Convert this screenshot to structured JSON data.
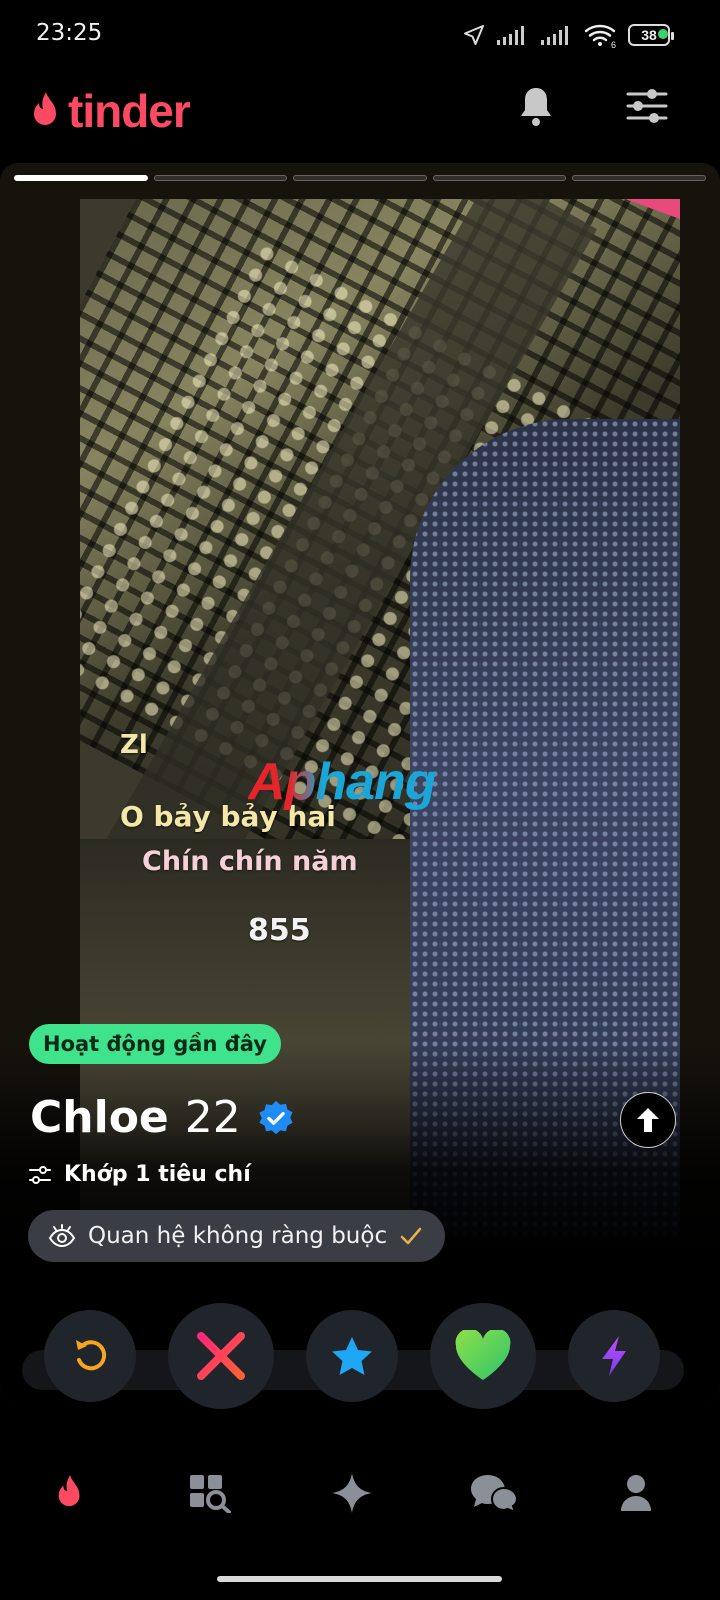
{
  "status_bar": {
    "time": "23:25",
    "battery": "38",
    "wifi_label": "6",
    "colors": {
      "dot": "#3ad36b"
    }
  },
  "header": {
    "logo_text": "tinder",
    "brand_color": "#fd4a63",
    "icons": [
      "flame-icon",
      "bell-icon",
      "filter-sliders-icon"
    ]
  },
  "card": {
    "photo_count": 5,
    "active_photo_index": 0,
    "photo_text": {
      "line1": "Zl",
      "line2": "O bảy bảy hai",
      "line3": "Chín chín năm",
      "line4": "855",
      "watermark": "Aphang"
    },
    "active_badge": "Hoạt động gần đây",
    "name": "Chloe",
    "age": "22",
    "match_text": "Khớp 1 tiêu chí",
    "interest": "Quan hệ không ràng buộc",
    "colors": {
      "badge": "#3ee38b",
      "verified": "#1f8bf5",
      "chip": "#3a3d44"
    }
  },
  "actions": [
    {
      "name": "rewind",
      "icon": "rewind-icon",
      "color": "#f7a51e"
    },
    {
      "name": "nope",
      "icon": "x-icon",
      "color": "#fd267a"
    },
    {
      "name": "super-like",
      "icon": "star-icon",
      "color": "#1ea7f6"
    },
    {
      "name": "like",
      "icon": "heart-icon",
      "color": "#6ad24b"
    },
    {
      "name": "boost",
      "icon": "lightning-icon",
      "color": "#a14bf2"
    }
  ],
  "bottom_nav": {
    "items": [
      "home-flame-icon",
      "explore-icon",
      "sparkle-icon",
      "chat-icon",
      "profile-icon"
    ],
    "active": "home-flame-icon"
  }
}
